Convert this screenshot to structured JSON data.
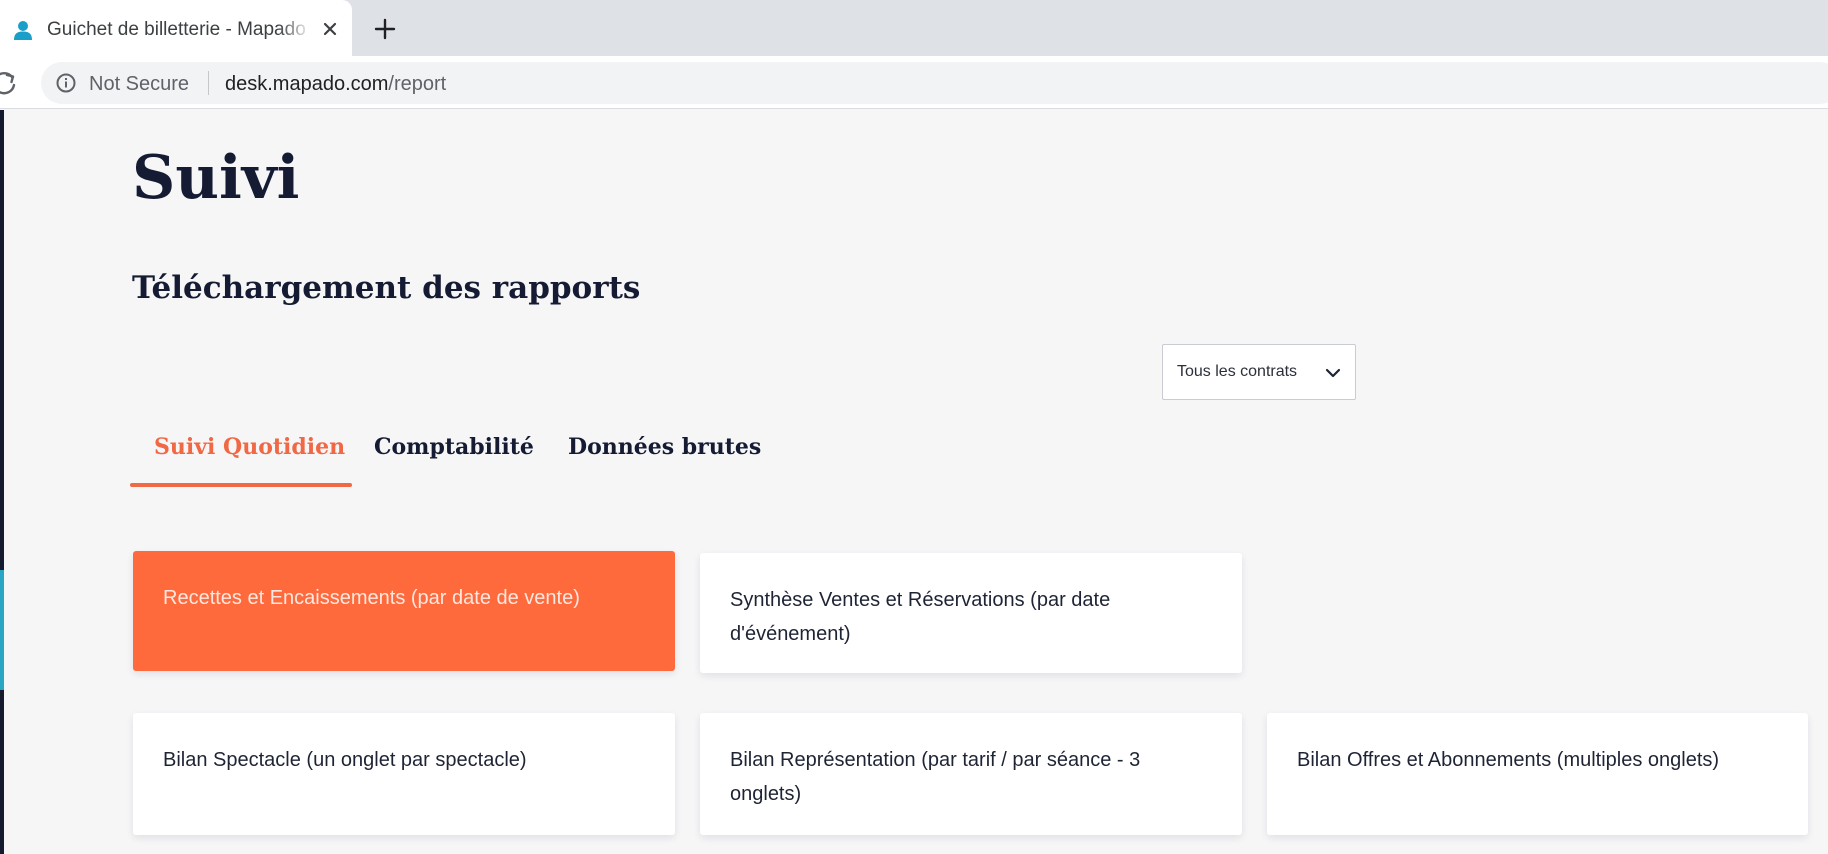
{
  "browser": {
    "tab_title": "Guichet de billetterie - Mapado",
    "security_label": "Not Secure",
    "url_host": "desk.mapado.com",
    "url_path": "/report"
  },
  "page": {
    "title": "Suivi",
    "section_title": "Téléchargement des rapports"
  },
  "contract_filter": {
    "selected": "Tous les contrats"
  },
  "tabs": [
    {
      "label": "Suivi Quotidien",
      "active": true
    },
    {
      "label": "Comptabilité",
      "active": false
    },
    {
      "label": "Données brutes",
      "active": false
    }
  ],
  "reports": [
    {
      "label": "Recettes et Encaissements (par date de vente)",
      "selected": true
    },
    {
      "label": "Synthèse Ventes et Réservations (par date d'événement)",
      "selected": false
    },
    {
      "label": "Bilan Spectacle (un onglet par spectacle)",
      "selected": false
    },
    {
      "label": "Bilan Représentation (par tarif / par séance - 3 onglets)",
      "selected": false
    },
    {
      "label": "Bilan Offres et Abonnements (multiples onglets)",
      "selected": false
    }
  ],
  "colors": {
    "accent": "#ff6a3d",
    "heading": "#141b33",
    "page_background": "#f6f6f7"
  },
  "icons": {
    "favicon": "user-icon",
    "close": "close-icon",
    "new_tab": "plus-icon",
    "reload": "reload-icon",
    "security": "info-icon",
    "dropdown": "chevron-down-icon"
  }
}
